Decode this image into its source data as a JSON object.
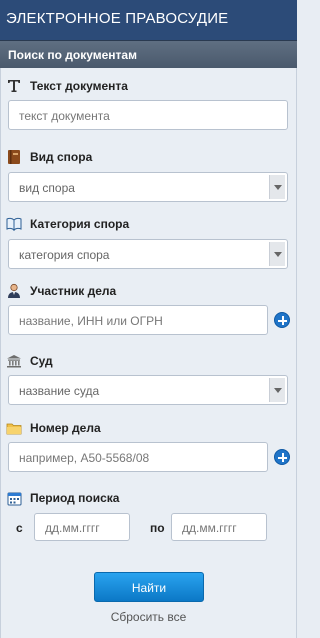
{
  "app": {
    "title": "ЭЛЕКТРОННОЕ ПРАВОСУДИЕ"
  },
  "panel": {
    "title": "Поиск по документам"
  },
  "fields": {
    "doc_text": {
      "label": "Текст документа",
      "placeholder": "текст документа",
      "icon": "letter-t-icon"
    },
    "dispute_type": {
      "label": "Вид спора",
      "placeholder": "вид спора",
      "icon": "book-icon"
    },
    "dispute_category": {
      "label": "Категория спора",
      "placeholder": "категория спора",
      "icon": "open-book-icon"
    },
    "participant": {
      "label": "Участник дела",
      "placeholder": "название, ИНН или ОГРН",
      "icon": "person-icon"
    },
    "court": {
      "label": "Суд",
      "placeholder": "название суда",
      "icon": "courthouse-icon"
    },
    "case_number": {
      "label": "Номер дела",
      "placeholder": "например, А50-5568/08",
      "icon": "folder-icon"
    },
    "period": {
      "label": "Период поиска",
      "icon": "calendar-icon",
      "from_label": "с",
      "to_label": "по",
      "from_placeholder": "дд.мм.гггг",
      "to_placeholder": "дд.мм.гггг"
    }
  },
  "actions": {
    "search_label": "Найти",
    "reset_label": "Сбросить все"
  },
  "colors": {
    "topbar": "#2c4b78",
    "panel_header": "#4f5f72",
    "button": "#1d8fdc",
    "add_icon": "#1f74c8"
  }
}
